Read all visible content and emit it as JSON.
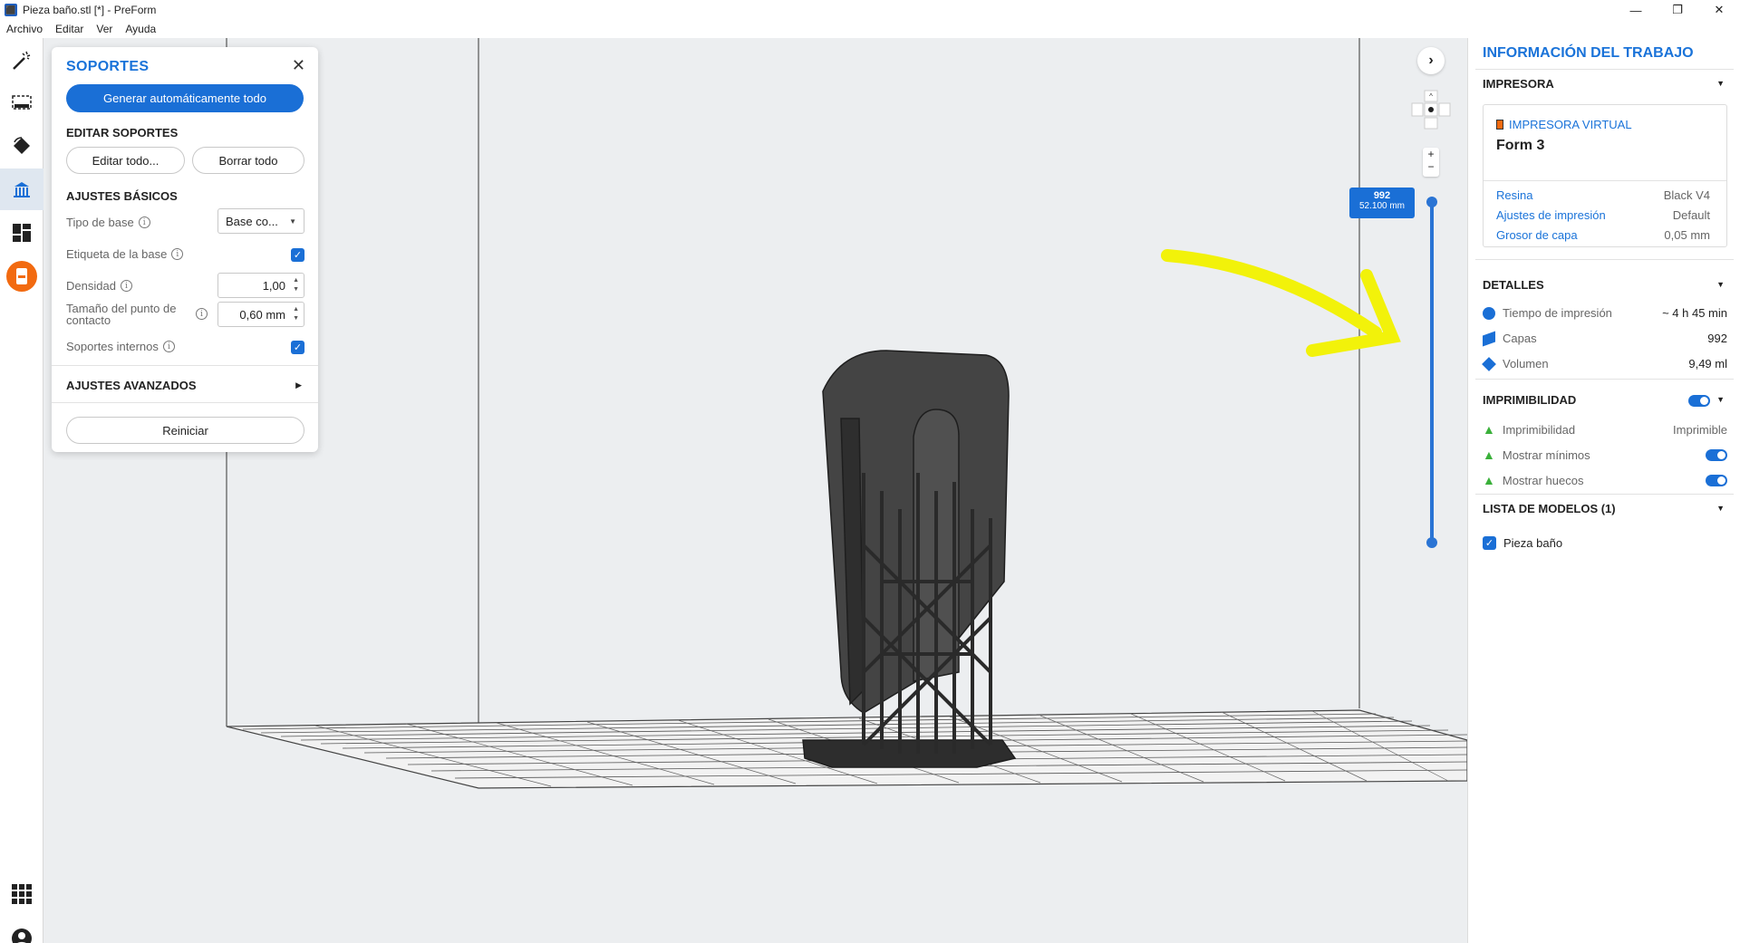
{
  "window": {
    "title": "Pieza baño.stl [*] - PreForm",
    "minimize": "—",
    "maximize": "❐",
    "close": "✕"
  },
  "menu": [
    "Archivo",
    "Editar",
    "Ver",
    "Ayuda"
  ],
  "toolbar": {
    "icons": [
      "magic-wand-icon",
      "select-icon",
      "orient-icon",
      "supports-icon",
      "layout-icon",
      "printer-icon",
      "apps-grid-icon",
      "account-icon"
    ],
    "active": "supports-icon"
  },
  "supports_panel": {
    "title": "SOPORTES",
    "close": "✕",
    "auto_generate": "Generar automáticamente todo",
    "edit_heading": "EDITAR SOPORTES",
    "edit_all": "Editar todo...",
    "delete_all": "Borrar todo",
    "basic_heading": "AJUSTES BÁSICOS",
    "base_type_label": "Tipo de base",
    "base_type_value": "Base co...",
    "base_label_label": "Etiqueta de la base",
    "base_label_checked": true,
    "density_label": "Densidad",
    "density_value": "1,00",
    "touchpoint_label_1": "Tamaño del punto de",
    "touchpoint_label_2": "contacto",
    "touchpoint_value": "0,60 mm",
    "internal_label": "Soportes internos",
    "internal_checked": true,
    "advanced_heading": "AJUSTES AVANZADOS",
    "reset": "Reiniciar"
  },
  "viewport": {
    "layer_badge_top": "992",
    "layer_badge_bottom": "52.100 mm",
    "next": "›",
    "zoom_in": "+",
    "zoom_out": "−"
  },
  "job_info": {
    "title": "INFORMACIÓN DEL TRABAJO",
    "printer_heading": "IMPRESORA",
    "printer_tag": "IMPRESORA VIRTUAL",
    "printer_name": "Form 3",
    "resin_label": "Resina",
    "resin_value": "Black V4",
    "settings_label": "Ajustes de impresión",
    "settings_value": "Default",
    "layer_label": "Grosor de capa",
    "layer_value": "0,05 mm",
    "details_heading": "DETALLES",
    "time_label": "Tiempo de impresión",
    "time_value": "~ 4 h 45 min",
    "layers_label": "Capas",
    "layers_value": "992",
    "volume_label": "Volumen",
    "volume_value": "9,49 ml",
    "printability_heading": "IMPRIMIBILIDAD",
    "printability_label": "Imprimibilidad",
    "printability_value": "Imprimible",
    "show_minima_label": "Mostrar mínimos",
    "show_holes_label": "Mostrar huecos",
    "models_heading": "LISTA DE MODELOS (1)",
    "model_name": "Pieza baño"
  },
  "colors": {
    "accent": "#1a6fd6",
    "annotation": "#f2f20a",
    "thumb": "#3ab03a"
  }
}
